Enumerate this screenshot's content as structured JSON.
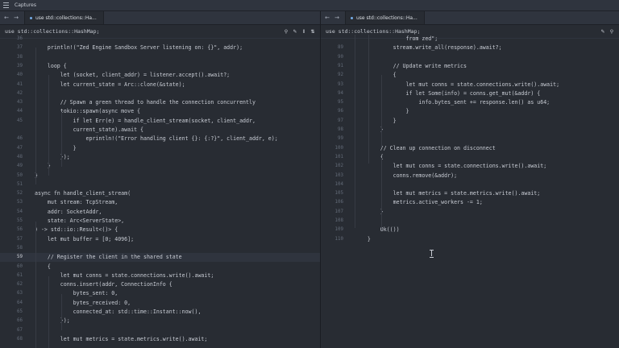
{
  "window": {
    "title": "Captures"
  },
  "left": {
    "tab_label": "use std::collections::Ha...",
    "breadcrumb": "use std::collections::HashMap;",
    "lines": [
      {
        "n": "36",
        "t": ""
      },
      {
        "n": "37",
        "t": "    println!(\"Zed Engine Sandbox Server listening on: {}\", addr);"
      },
      {
        "n": "38",
        "t": ""
      },
      {
        "n": "39",
        "t": "    loop {"
      },
      {
        "n": "40",
        "t": "        let (socket, client_addr) = listener.accept().await?;"
      },
      {
        "n": "41",
        "t": "        let current_state = Arc::clone(&state);"
      },
      {
        "n": "42",
        "t": ""
      },
      {
        "n": "43",
        "t": "        // Spawn a green thread to handle the connection concurrently"
      },
      {
        "n": "44",
        "t": "        tokio::spawn(async move {"
      },
      {
        "n": "45",
        "t": "            if let Err(e) = handle_client_stream(socket, client_addr,"
      },
      {
        "n": "",
        "t": "            current_state).await {"
      },
      {
        "n": "46",
        "t": "                eprintln!(\"Error handling client {}: {:?}\", client_addr, e);"
      },
      {
        "n": "47",
        "t": "            }"
      },
      {
        "n": "48",
        "t": "        });"
      },
      {
        "n": "49",
        "t": "    }"
      },
      {
        "n": "50",
        "t": "}"
      },
      {
        "n": "51",
        "t": ""
      },
      {
        "n": "52",
        "t": "async fn handle_client_stream("
      },
      {
        "n": "53",
        "t": "    mut stream: TcpStream,"
      },
      {
        "n": "54",
        "t": "    addr: SocketAddr,"
      },
      {
        "n": "55",
        "t": "    state: Arc<ServerState>,"
      },
      {
        "n": "56",
        "t": ") -> std::io::Result<()> {"
      },
      {
        "n": "57",
        "t": "    let mut buffer = [0; 4096];"
      },
      {
        "n": "58",
        "t": ""
      },
      {
        "n": "59",
        "t": "    // Register the client in the shared state",
        "active": true
      },
      {
        "n": "60",
        "t": "    {"
      },
      {
        "n": "61",
        "t": "        let mut conns = state.connections.write().await;"
      },
      {
        "n": "62",
        "t": "        conns.insert(addr, ConnectionInfo {"
      },
      {
        "n": "63",
        "t": "            bytes_sent: 0,"
      },
      {
        "n": "64",
        "t": "            bytes_received: 0,"
      },
      {
        "n": "65",
        "t": "            connected_at: std::time::Instant::now(),"
      },
      {
        "n": "66",
        "t": "        });"
      },
      {
        "n": "67",
        "t": ""
      },
      {
        "n": "68",
        "t": "        let mut metrics = state.metrics.write().await;"
      }
    ]
  },
  "right": {
    "tab_label": "use std::collections::Ha...",
    "breadcrumb": "use std::collections::HashMap;",
    "lines": [
      {
        "n": "",
        "t": "                from zed\";"
      },
      {
        "n": "89",
        "t": "            stream.write_all(response).await?;"
      },
      {
        "n": "90",
        "t": ""
      },
      {
        "n": "91",
        "t": "            // Update write metrics"
      },
      {
        "n": "92",
        "t": "            {"
      },
      {
        "n": "93",
        "t": "                let mut conns = state.connections.write().await;"
      },
      {
        "n": "94",
        "t": "                if let Some(info) = conns.get_mut(&addr) {"
      },
      {
        "n": "95",
        "t": "                    info.bytes_sent += response.len() as u64;"
      },
      {
        "n": "96",
        "t": "                }"
      },
      {
        "n": "97",
        "t": "            }"
      },
      {
        "n": "98",
        "t": "        }"
      },
      {
        "n": "99",
        "t": ""
      },
      {
        "n": "100",
        "t": "        // Clean up connection on disconnect"
      },
      {
        "n": "101",
        "t": "        {"
      },
      {
        "n": "102",
        "t": "            let mut conns = state.connections.write().await;"
      },
      {
        "n": "103",
        "t": "            conns.remove(&addr);"
      },
      {
        "n": "104",
        "t": ""
      },
      {
        "n": "105",
        "t": "            let mut metrics = state.metrics.write().await;"
      },
      {
        "n": "106",
        "t": "            metrics.active_workers -= 1;"
      },
      {
        "n": "107",
        "t": "        }"
      },
      {
        "n": "108",
        "t": ""
      },
      {
        "n": "109",
        "t": "        Ok(())"
      },
      {
        "n": "110",
        "t": "    }"
      }
    ]
  },
  "colors": {
    "background": "#282c33",
    "chrome": "#2f343e",
    "text": "#c8ccd4",
    "line_number": "#636b78",
    "accent": "#74ade8"
  },
  "icons": {
    "nav_back": "arrow-left-icon",
    "nav_forward": "arrow-right-icon",
    "toolbar": [
      "search-icon",
      "code-actions-icon",
      "inline-assist-icon",
      "split-pane-icon"
    ]
  }
}
